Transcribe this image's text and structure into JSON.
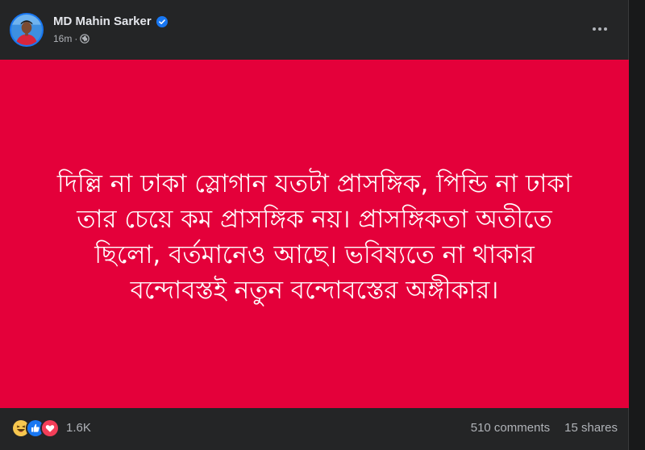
{
  "post": {
    "author": "MD Mahin Sarker",
    "time": "16m",
    "separator": "·",
    "verified_icon": "verified-badge-icon",
    "audience_icon": "globe-icon",
    "more_icon": "more-options-icon",
    "image_text": "দিল্লি না ঢাকা স্লোগান যতটা প্রাসঙ্গিক, পিন্ডি না ঢাকা তার চেয়ে কম প্রাসঙ্গিক নয়। প্রাসঙ্গিকতা অতীতে ছিলো, বর্তমানেও আছে। ভবিষ্যতে না থাকার বন্দোবস্তই নতুন বন্দোবস্তের অঙ্গীকার।",
    "image_background": "#e4003a",
    "reactions": {
      "icons": [
        "haha-reaction-icon",
        "like-reaction-icon",
        "love-reaction-icon"
      ],
      "count": "1.6K"
    },
    "comments": "510 comments",
    "shares": "15 shares"
  },
  "colors": {
    "card_bg": "#242526",
    "page_bg": "#18191a",
    "primary_text": "#e4e6eb",
    "secondary_text": "#b0b3b8",
    "verified_blue": "#1877f2"
  }
}
